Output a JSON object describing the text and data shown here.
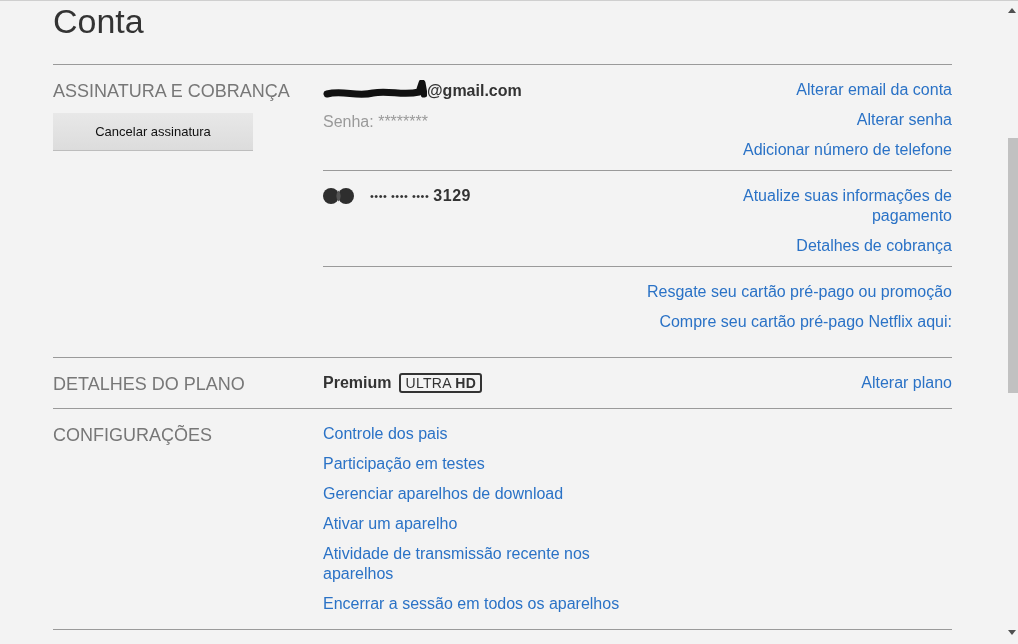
{
  "page": {
    "title": "Conta"
  },
  "sections": [
    {
      "kind": "membership",
      "heading": "ASSINATURA E COBRANÇA",
      "button": "Cancelar assinatura",
      "blocks": [
        {
          "kind": "account",
          "email": "@gmail.com",
          "password": "Senha: ********",
          "links": [
            "Alterar email da conta",
            "Alterar senha",
            "Adicionar número de telefone"
          ]
        },
        {
          "kind": "payment",
          "card_mask": "•••• •••• ••••",
          "card_last_digits": "3129",
          "links": [
            "Atualize suas informações de pagamento",
            "Detalhes de cobrança"
          ]
        },
        {
          "kind": "gift",
          "links": [
            "Resgate seu cartão pré-pago ou promoção",
            "Compre seu cartão pré-pago Netflix aqui:"
          ]
        }
      ]
    },
    {
      "kind": "plan",
      "heading": "DETALHES DO PLANO",
      "plan": "Premium",
      "badge": "ULTRA **HD**",
      "links": [
        "Alterar plano"
      ]
    },
    {
      "kind": "settings",
      "heading": "CONFIGURAÇÕES",
      "links": [
        "Controle dos pais",
        "Participação em testes",
        "Gerenciar aparelhos de download",
        "Ativar um aparelho",
        "Atividade de transmissão recente nos aparelhos",
        "Encerrar a sessão em todos os aparelhos"
      ]
    }
  ]
}
